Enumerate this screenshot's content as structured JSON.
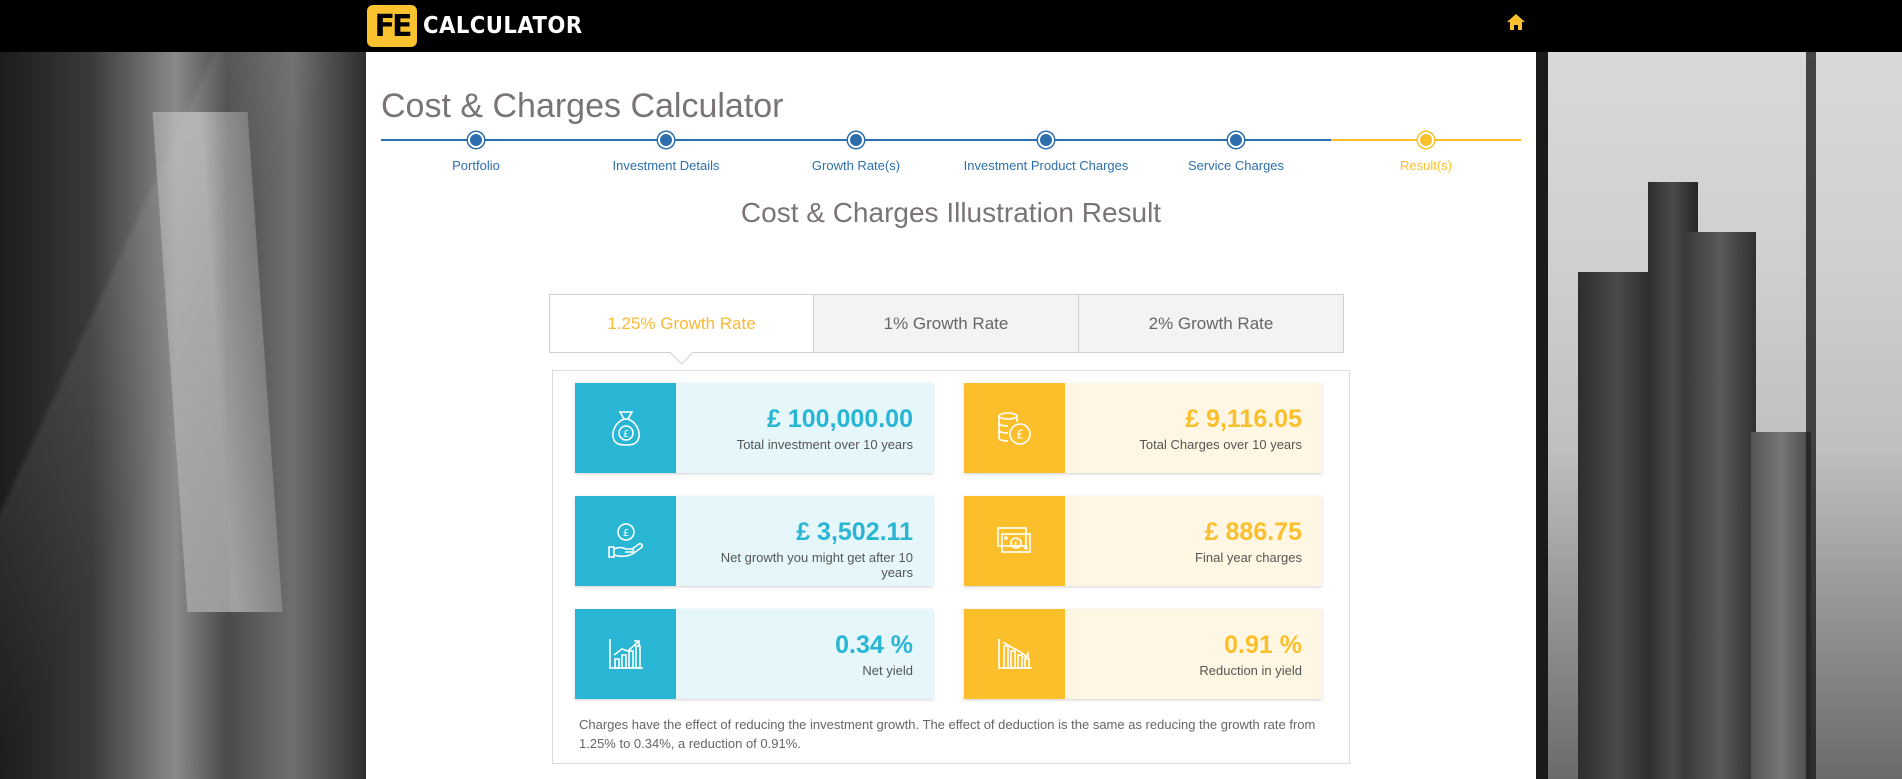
{
  "brand": {
    "logo_mark": "FE",
    "logo_text": "CALCULATOR"
  },
  "nav": {
    "home_icon": "home-icon"
  },
  "page": {
    "title": "Cost & Charges Calculator"
  },
  "steps": [
    {
      "label": "Portfolio",
      "state": "done"
    },
    {
      "label": "Investment Details",
      "state": "done"
    },
    {
      "label": "Growth Rate(s)",
      "state": "done"
    },
    {
      "label": "Investment Product Charges",
      "state": "done"
    },
    {
      "label": "Service Charges",
      "state": "done"
    },
    {
      "label": "Result(s)",
      "state": "current"
    }
  ],
  "result": {
    "title": "Cost & Charges Illustration Result",
    "tabs": [
      {
        "label": "1.25% Growth Rate",
        "active": true
      },
      {
        "label": "1% Growth Rate",
        "active": false
      },
      {
        "label": "2% Growth Rate",
        "active": false
      }
    ],
    "cards": [
      {
        "value": "£ 100,000.00",
        "description": "Total investment over 10 years",
        "icon": "money-bag-icon",
        "theme": "blue"
      },
      {
        "value": "£ 9,116.05",
        "description": "Total Charges over 10 years",
        "icon": "coin-stack-icon",
        "theme": "gold"
      },
      {
        "value": "£ 3,502.11",
        "description": "Net growth you might get after 10 years",
        "icon": "hand-coin-icon",
        "theme": "blue"
      },
      {
        "value": "£ 886.75",
        "description": "Final year charges",
        "icon": "banknote-icon",
        "theme": "gold"
      },
      {
        "value": "0.34 %",
        "description": "Net yield",
        "icon": "growth-chart-icon",
        "theme": "blue"
      },
      {
        "value": "0.91 %",
        "description": "Reduction in yield",
        "icon": "decline-chart-icon",
        "theme": "gold"
      }
    ],
    "note": "Charges have the effect of reducing the investment growth. The effect of deduction is the same as reducing the growth rate from 1.25% to 0.34%, a reduction of 0.91%."
  },
  "colors": {
    "accent_gold": "#fbbf2c",
    "accent_blue": "#29b6d5",
    "step_blue": "#2d6fad",
    "title_gray": "#7a7472"
  }
}
